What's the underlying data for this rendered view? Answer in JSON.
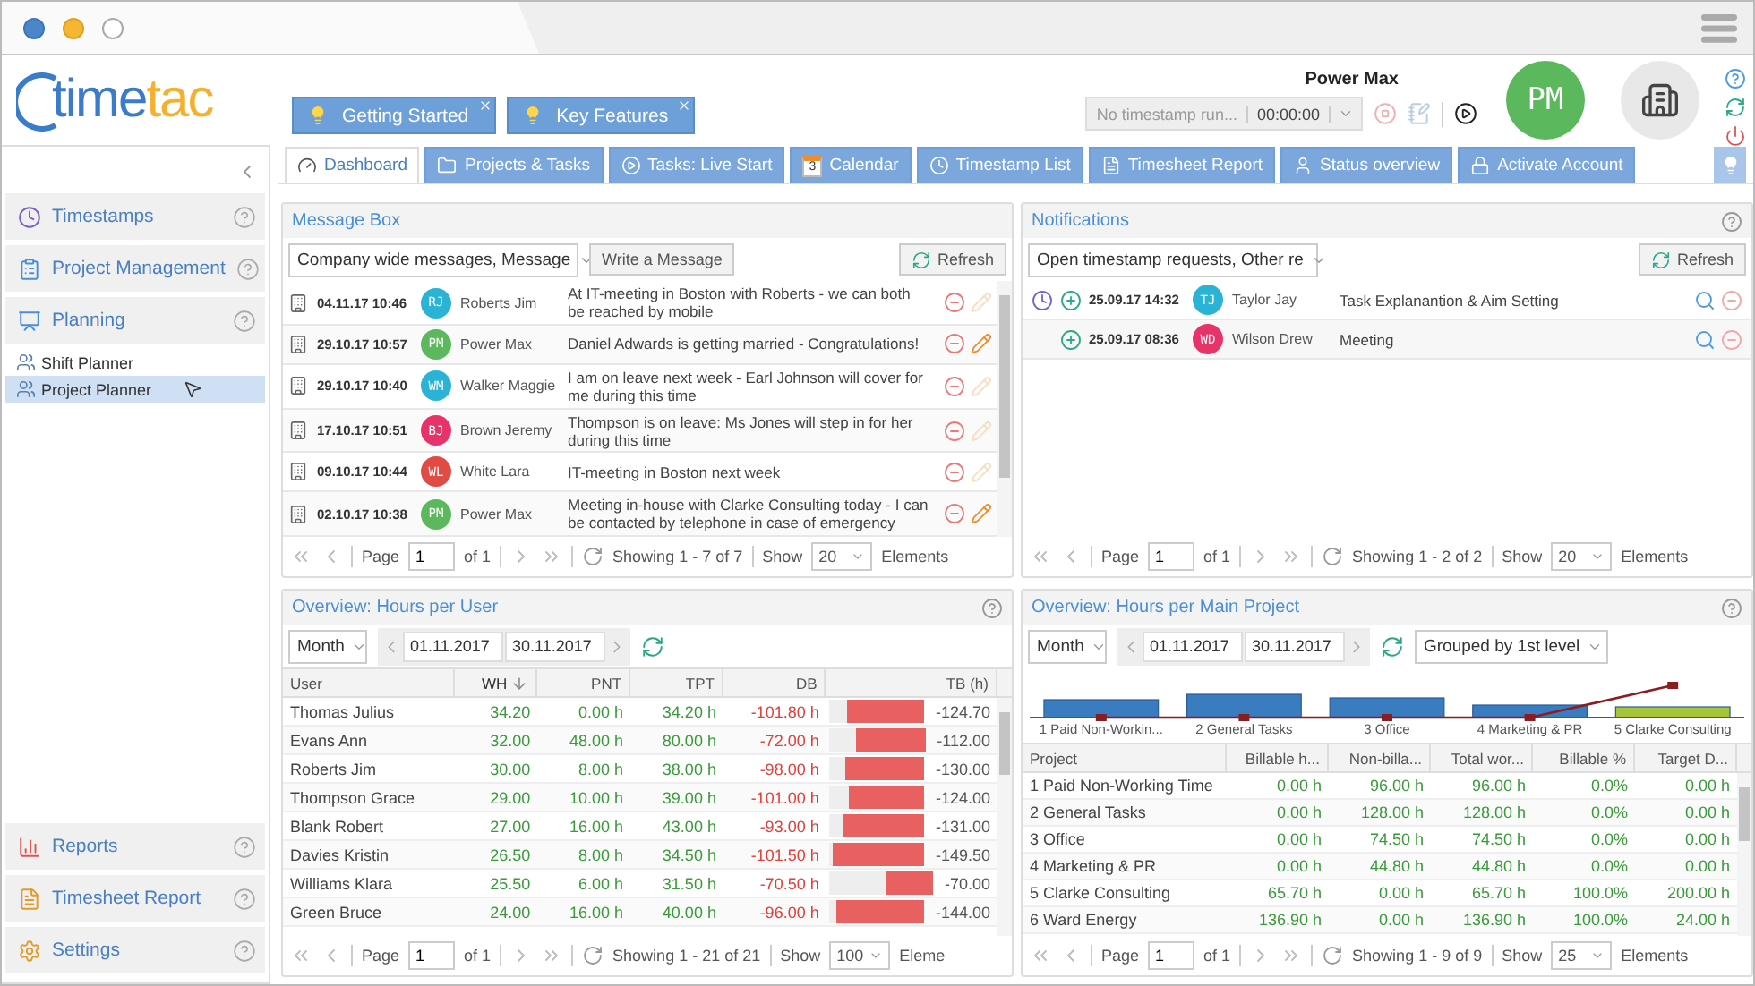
{
  "logo": {
    "primary": "time",
    "accent": "tac"
  },
  "tips": [
    {
      "label": "Getting Started"
    },
    {
      "label": "Key Features"
    }
  ],
  "timer": {
    "status": "No timestamp run...",
    "time": "00:00:00"
  },
  "user": {
    "name": "Power Max",
    "initials": "PM",
    "color": "#5cb85c"
  },
  "sidebar": {
    "sections": [
      {
        "label": "Timestamps"
      },
      {
        "label": "Project Management"
      },
      {
        "label": "Planning",
        "children": [
          {
            "label": "Shift Planner",
            "selected": false
          },
          {
            "label": "Project Planner",
            "selected": true
          }
        ]
      }
    ],
    "bottom": [
      {
        "label": "Reports"
      },
      {
        "label": "Timesheet Report"
      },
      {
        "label": "Settings"
      }
    ]
  },
  "tabs": [
    {
      "label": "Dashboard",
      "selected": true
    },
    {
      "label": "Projects & Tasks",
      "selected": false
    },
    {
      "label": "Tasks: Live Start",
      "selected": false
    },
    {
      "label": "Calendar",
      "badge": "3",
      "selected": false
    },
    {
      "label": "Timestamp List",
      "selected": false
    },
    {
      "label": "Timesheet Report",
      "selected": false
    },
    {
      "label": "Status overview",
      "selected": false
    },
    {
      "label": "Activate Account",
      "selected": false
    }
  ],
  "messages": {
    "title": "Message Box",
    "filter": "Company wide messages, Message",
    "write_button": "Write a Message",
    "refresh_button": "Refresh",
    "rows": [
      {
        "date": "04.11.17 10:46",
        "initials": "RJ",
        "color": "#2bb3d5",
        "name": "Roberts Jim",
        "text": "At IT-meeting in Boston with Roberts - we can both be reached by mobile",
        "editable": false
      },
      {
        "date": "29.10.17 10:57",
        "initials": "PM",
        "color": "#5cb85c",
        "name": "Power Max",
        "text": "Daniel Adwards is getting married - Congratulations!",
        "editable": true
      },
      {
        "date": "29.10.17 10:40",
        "initials": "WM",
        "color": "#2bb3d5",
        "name": "Walker Maggie",
        "text": "I am on leave next week - Earl Johnson will cover for me during this time",
        "editable": false
      },
      {
        "date": "17.10.17 10:51",
        "initials": "BJ",
        "color": "#e8336a",
        "name": "Brown Jeremy",
        "text": "Thompson is on leave: Ms Jones will step in for her during this time",
        "editable": false
      },
      {
        "date": "09.10.17 10:44",
        "initials": "WL",
        "color": "#e14b45",
        "name": "White Lara",
        "text": "IT-meeting in Boston next week",
        "editable": false
      },
      {
        "date": "02.10.17 10:38",
        "initials": "PM",
        "color": "#5cb85c",
        "name": "Power Max",
        "text": "Meeting in-house with Clarke Consulting today - I can be contacted by telephone in case of emergency",
        "editable": true
      }
    ],
    "pager": {
      "page_label": "Page",
      "page": "1",
      "of": "of 1",
      "showing": "Showing 1 - 7 of 7",
      "show_label": "Show",
      "show": "20",
      "elements": "Elements"
    }
  },
  "notifications": {
    "title": "Notifications",
    "filter": "Open timestamp requests, Other re",
    "refresh_button": "Refresh",
    "rows": [
      {
        "kind": "timestamp",
        "date": "25.09.17 14:32",
        "initials": "TJ",
        "color": "#2bb3d5",
        "name": "Taylor Jay",
        "text": "Task Explanantion & Aim Setting"
      },
      {
        "kind": "request",
        "date": "25.09.17 08:36",
        "initials": "WD",
        "color": "#e8336a",
        "name": "Wilson Drew",
        "text": "Meeting"
      }
    ],
    "pager": {
      "page_label": "Page",
      "page": "1",
      "of": "of 1",
      "showing": "Showing 1 - 2 of 2",
      "show_label": "Show",
      "show": "20",
      "elements": "Elements"
    }
  },
  "hours_user": {
    "title": "Overview: Hours per User",
    "period": "Month",
    "from": "01.11.2017",
    "to": "30.11.2017",
    "columns": [
      {
        "label": "User",
        "sorted": false
      },
      {
        "label": "WH",
        "sorted": true
      },
      {
        "label": "PNT",
        "sorted": false
      },
      {
        "label": "TPT",
        "sorted": false
      },
      {
        "label": "DB",
        "sorted": false
      },
      {
        "label": "TB (h)",
        "sorted": false
      }
    ],
    "rows": [
      {
        "cells": [
          "Thomas Julius",
          "34.20",
          "0.00 h",
          "34.20 h",
          "-101.80 h"
        ],
        "tb": {
          "level": 0.81,
          "value": "-124.70"
        }
      },
      {
        "cells": [
          "Evans Ann",
          "32.00",
          "48.00 h",
          "80.00 h",
          "-72.00 h"
        ],
        "tb": {
          "level": 0.73,
          "value": "-112.00"
        }
      },
      {
        "cells": [
          "Roberts Jim",
          "30.00",
          "8.00 h",
          "38.00 h",
          "-98.00 h"
        ],
        "tb": {
          "level": 0.84,
          "value": "-130.00"
        }
      },
      {
        "cells": [
          "Thompson Grace",
          "29.00",
          "10.00 h",
          "39.00 h",
          "-101.00 h"
        ],
        "tb": {
          "level": 0.8,
          "value": "-124.00"
        }
      },
      {
        "cells": [
          "Blank Robert",
          "27.00",
          "16.00 h",
          "43.00 h",
          "-93.00 h"
        ],
        "tb": {
          "level": 0.85,
          "value": "-131.00"
        }
      },
      {
        "cells": [
          "Davies Kristin",
          "26.50",
          "8.00 h",
          "34.50 h",
          "-101.50 h"
        ],
        "tb": {
          "level": 0.97,
          "value": "-149.50"
        }
      },
      {
        "cells": [
          "Williams Klara",
          "25.50",
          "6.00 h",
          "31.50 h",
          "-70.50 h"
        ],
        "tb": {
          "level": 0.45,
          "value": "-70.00"
        }
      },
      {
        "cells": [
          "Green Bruce",
          "24.00",
          "16.00 h",
          "40.00 h",
          "-96.00 h"
        ],
        "tb": {
          "level": 0.93,
          "value": "-144.00"
        }
      }
    ],
    "pager": {
      "page_label": "Page",
      "page": "1",
      "of": "of 1",
      "showing": "Showing 1 - 21 of 21",
      "show_label": "Show",
      "show": "100",
      "elements": "Eleme"
    }
  },
  "hours_project": {
    "title": "Overview: Hours per Main Project",
    "period": "Month",
    "from": "01.11.2017",
    "to": "30.11.2017",
    "grouping": "Grouped by 1st level",
    "chart_labels": [
      "1 Paid Non-Workin...",
      "2 General Tasks",
      "3 Office",
      "4 Marketing & PR",
      "5 Clarke Consulting"
    ],
    "columns": [
      {
        "label": "Project"
      },
      {
        "label": "Billable h..."
      },
      {
        "label": "Non-billa..."
      },
      {
        "label": "Total wor..."
      },
      {
        "label": "Billable %"
      },
      {
        "label": "Target D..."
      }
    ],
    "rows": [
      {
        "cells": [
          "1 Paid Non-Working Time",
          "0.00 h",
          "96.00 h",
          "96.00 h",
          "0.0%",
          "0.00 h"
        ]
      },
      {
        "cells": [
          "2 General Tasks",
          "0.00 h",
          "128.00 h",
          "128.00 h",
          "0.0%",
          "0.00 h"
        ]
      },
      {
        "cells": [
          "3 Office",
          "0.00 h",
          "74.50 h",
          "74.50 h",
          "0.0%",
          "0.00 h"
        ]
      },
      {
        "cells": [
          "4 Marketing & PR",
          "0.00 h",
          "44.80 h",
          "44.80 h",
          "0.0%",
          "0.00 h"
        ]
      },
      {
        "cells": [
          "5 Clarke Consulting",
          "65.70 h",
          "0.00 h",
          "65.70 h",
          "100.0%",
          "200.00 h"
        ]
      },
      {
        "cells": [
          "6 Ward Energy",
          "136.90 h",
          "0.00 h",
          "136.90 h",
          "100.0%",
          "24.00 h"
        ]
      }
    ],
    "pager": {
      "page_label": "Page",
      "page": "1",
      "of": "of 1",
      "showing": "Showing 1 - 9 of 9",
      "show_label": "Show",
      "show": "25",
      "elements": "Elements"
    }
  }
}
